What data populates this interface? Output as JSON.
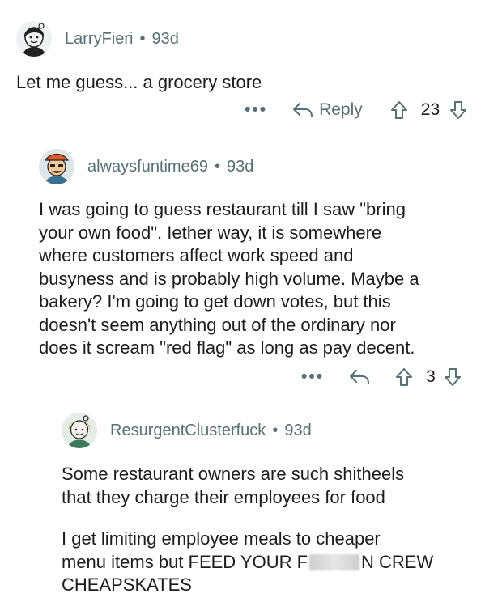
{
  "comments": [
    {
      "username": "LarryFieri",
      "dot": "•",
      "age": "93d",
      "body": [
        "Let me guess... a grocery store"
      ],
      "more_label": "•••",
      "reply_label": "Reply",
      "votes": "23"
    },
    {
      "username": "alwaysfuntime69",
      "dot": "•",
      "age": "93d",
      "body": [
        "I was going to guess restaurant till I saw \"bring",
        "your own food\". Iether way, it is somewhere",
        "where customers affect work speed and",
        "busyness and is probably high volume. Maybe a",
        "bakery? I'm going to get down votes, but this",
        "doesn't seem anything out of the ordinary nor",
        "does it scream \"red flag\" as long as pay decent."
      ],
      "more_label": "•••",
      "votes": "3"
    },
    {
      "username": "ResurgentClusterfuck",
      "dot": "•",
      "age": "93d",
      "body": [
        "Some restaurant owners are such shitheels",
        "that they charge their employees for food"
      ],
      "body2_line1": "I get limiting employee meals to cheaper",
      "body2_line2_pre": "menu items but FEED YOUR F",
      "body2_line2_post": "N CREW",
      "body2_line3": "CHEAPSKATES"
    }
  ]
}
